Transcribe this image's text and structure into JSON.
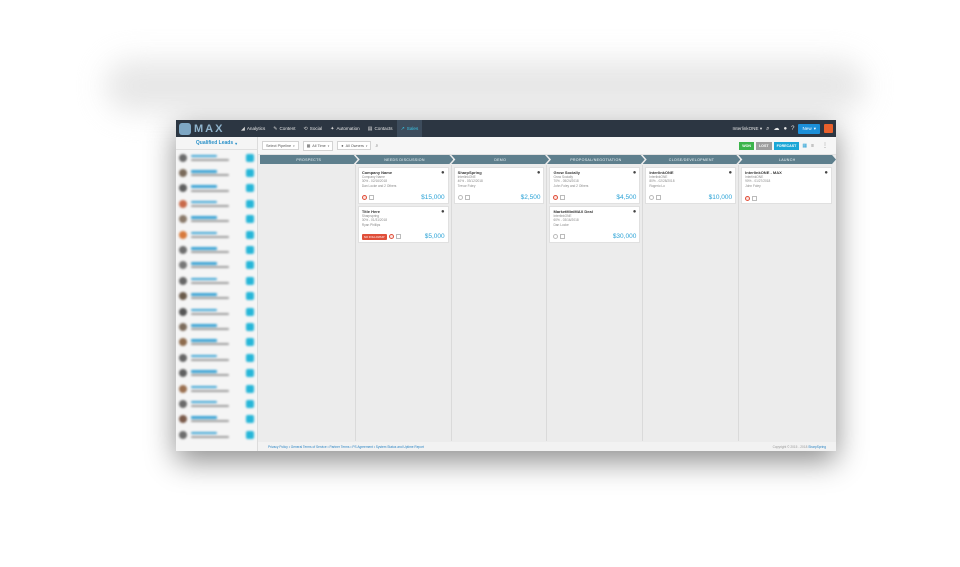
{
  "app": {
    "logo": "MAX"
  },
  "nav": {
    "items": [
      {
        "label": "Analytics",
        "icon": "chart-icon"
      },
      {
        "label": "Content",
        "icon": "pencil-icon"
      },
      {
        "label": "Social",
        "icon": "share-icon"
      },
      {
        "label": "Automation",
        "icon": "wand-icon"
      },
      {
        "label": "Contacts",
        "icon": "contacts-icon"
      },
      {
        "label": "Sales",
        "icon": "sales-icon",
        "active": true
      }
    ],
    "org": "InterlinkONE",
    "new_label": "New"
  },
  "sidebar": {
    "title": "Qualified Leads",
    "lead_count": 19
  },
  "toolbar": {
    "pipeline": "Select Pipeline",
    "view": "All Time",
    "owners": "All Owners",
    "won": "WON",
    "lost": "LOST",
    "forecast": "FORECAST"
  },
  "stages": [
    "PROSPECTS",
    "NEEDS DISCUSSION",
    "DEMO",
    "PROPOSAL/NEGOTIATION",
    "CLOSE/DEVELOPMENT",
    "LAUNCH"
  ],
  "cards": [
    [],
    [
      {
        "title": "Company Name",
        "lines": [
          "Company Name",
          "30% - 02/16/2018",
          "Dan Locke and 2 Others"
        ],
        "amount": "$15,000",
        "badge": ""
      },
      {
        "title": "Title Here",
        "lines": [
          "Sharpspring",
          "30% - 01/31/2018",
          "Ryan Phillips"
        ],
        "amount": "$5,000",
        "badge": "NO FOLLOWUP"
      }
    ],
    [
      {
        "title": "SharpSpring",
        "lines": [
          "InterlinkONE",
          "40% - 03/12/2018",
          "Trevor Foley"
        ],
        "amount": "$2,500",
        "badge": ""
      }
    ],
    [
      {
        "title": "Grow Socially",
        "lines": [
          "Grow Socially",
          "70% - 05/24/2018",
          "John Foley and 2 Others"
        ],
        "amount": "$4,500",
        "badge": ""
      },
      {
        "title": "MarketMiniMAX Deal",
        "lines": [
          "InterlinkONE",
          "60% - 03/16/2018",
          "Dan Locke"
        ],
        "amount": "$30,000",
        "badge": ""
      }
    ],
    [
      {
        "title": "InterlinkONE",
        "lines": [
          "InterlinkONE",
          "80% - 02/28/2018",
          "Rogerio Lo"
        ],
        "amount": "$10,000",
        "badge": ""
      }
    ],
    [
      {
        "title": "InterlinkONE - MAX",
        "lines": [
          "InterlinkONE",
          "90% - 01/27/2018",
          "John Foley"
        ],
        "amount": "",
        "badge": ""
      }
    ]
  ],
  "footer": {
    "links": "Privacy Policy • General Terms of Service • Partner Terms • PS Agreement • System Status and Uptime Report",
    "copyright": "Copyright © 2015 - 2018",
    "brand": "SharpSpring"
  }
}
